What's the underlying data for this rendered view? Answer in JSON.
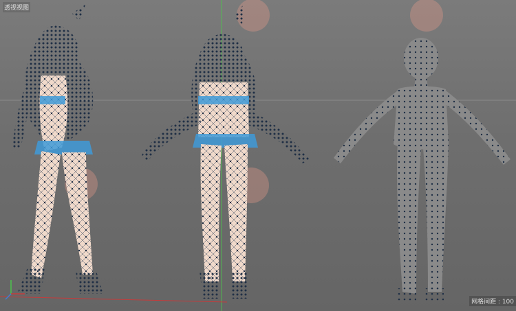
{
  "viewport": {
    "name": "透视视图",
    "grid_spacing_label": "网格间距 : 100"
  },
  "colors": {
    "background": "#6f6f6f",
    "mesh_points": "#1f2f45",
    "mesh_accent": "#3f9ad8",
    "skin": "#f1dacb",
    "axis_x": "#c63b3b",
    "axis_y": "#4cc44c"
  }
}
